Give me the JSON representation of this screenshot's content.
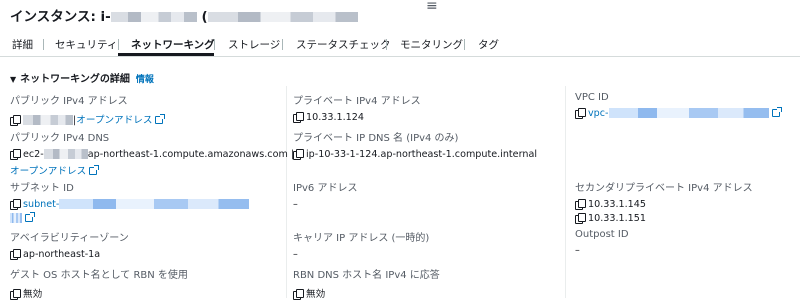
{
  "header": {
    "title_prefix": "インスタンス: i-",
    "menu_glyph": "≡"
  },
  "tabs": [
    {
      "label": "詳細"
    },
    {
      "label": "セキュリティ"
    },
    {
      "label": "ネットワーキング",
      "active": true
    },
    {
      "label": "ストレージ"
    },
    {
      "label": "ステータスチェック"
    },
    {
      "label": "モニタリング"
    },
    {
      "label": "タグ"
    }
  ],
  "section": {
    "title": "ネットワーキングの詳細",
    "info": "情報"
  },
  "fields": {
    "public_ipv4": {
      "label": "パブリック IPv4 アドレス",
      "link": "オープンアドレス"
    },
    "private_ipv4": {
      "label": "プライベート IPv4 アドレス",
      "value": "10.33.1.124"
    },
    "vpc_id": {
      "label": "VPC ID",
      "value_prefix": "vpc-"
    },
    "public_dns": {
      "label": "パブリック IPv4 DNS",
      "value_prefix": "ec2-",
      "value_suffix": "ap-northeast-1.compute.amazonaws.com |",
      "link": "オープンアドレス"
    },
    "private_dns": {
      "label": "プライベート IP DNS 名 (IPv4 のみ)",
      "value": "ip-10-33-1-124.ap-northeast-1.compute.internal"
    },
    "subnet_id": {
      "label": "サブネット ID",
      "value_prefix": "subnet-"
    },
    "ipv6": {
      "label": "IPv6 アドレス",
      "value": "–"
    },
    "secondary_private_ipv4": {
      "label": "セカンダリプライベート IPv4 アドレス",
      "values": [
        "10.33.1.145",
        "10.33.1.151"
      ]
    },
    "az": {
      "label": "アベイラビリティーゾーン",
      "value": "ap-northeast-1a"
    },
    "carrier_ip": {
      "label": "キャリア IP アドレス (一時的)",
      "value": "–"
    },
    "outpost_id": {
      "label": "Outpost ID",
      "value": "–"
    },
    "guest_os_rbn": {
      "label": "ゲスト OS ホスト名として RBN を使用",
      "value": "無効"
    },
    "rbn_dns": {
      "label": "RBN DNS ホスト名 IPv4 に応答",
      "value": "無効"
    }
  }
}
